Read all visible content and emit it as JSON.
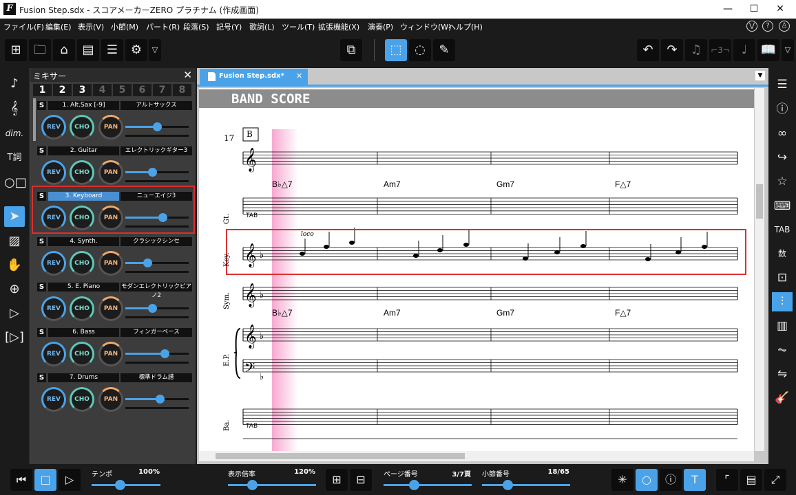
{
  "window": {
    "title": "Fusion Step.sdx - スコアメーカーZERO プラチナム (作成画面)",
    "app_icon": "F"
  },
  "menu": [
    "ファイル(F)",
    "編集(E)",
    "表示(V)",
    "小節(M)",
    "パート(R)",
    "段落(S)",
    "記号(Y)",
    "歌詞(L)",
    "ツール(T)",
    "拡張機能(X)",
    "演奏(P)",
    "ウィンドウ(W)",
    "ヘルプ(H)"
  ],
  "mixer": {
    "title": "ミキサー",
    "tabs": [
      "1",
      "2",
      "3",
      "4",
      "5",
      "6",
      "7",
      "8"
    ],
    "solo_label": "S",
    "knob_labels": {
      "rev": "REV",
      "cho": "CHO",
      "pan": "PAN"
    },
    "channels": [
      {
        "name": "1. Alt.Sax [-9]",
        "instrument": "アルトサックス",
        "volume": 0.5,
        "selected": false
      },
      {
        "name": "2. Guitar",
        "instrument": "エレクトリックギター3",
        "volume": 0.42,
        "selected": false
      },
      {
        "name": "3. Keyboard",
        "instrument": "ニューエイジ3",
        "volume": 0.59,
        "selected": true
      },
      {
        "name": "4. Synth.",
        "instrument": "クラシックシンセ",
        "volume": 0.35,
        "selected": false
      },
      {
        "name": "5. E. Piano",
        "instrument": "モダンエレクトリックピアノ2",
        "volume": 0.42,
        "selected": false
      },
      {
        "name": "6. Bass",
        "instrument": "フィンガーベース",
        "volume": 0.62,
        "selected": false
      },
      {
        "name": "7. Drums",
        "instrument": "標準ドラム譜",
        "volume": 0.54,
        "selected": false
      }
    ]
  },
  "document": {
    "tab_name": "Fusion Step.sdx*",
    "banner": "BAND SCORE",
    "measure_number": "17",
    "rehearsal_mark": "B",
    "chords": [
      "B♭△7",
      "Am7",
      "Gm7",
      "F△7"
    ],
    "parts": [
      "Gt.",
      "Key.",
      "Sym.",
      "E.P.",
      "Ba."
    ],
    "loco": "loco"
  },
  "bottom": {
    "tempo_label": "テンポ",
    "tempo_value": "100%",
    "zoom_label": "表示倍率",
    "zoom_value": "120%",
    "page_label": "ページ番号",
    "page_value": "3/7頁",
    "measure_label": "小節番号",
    "measure_value": "18/65"
  }
}
